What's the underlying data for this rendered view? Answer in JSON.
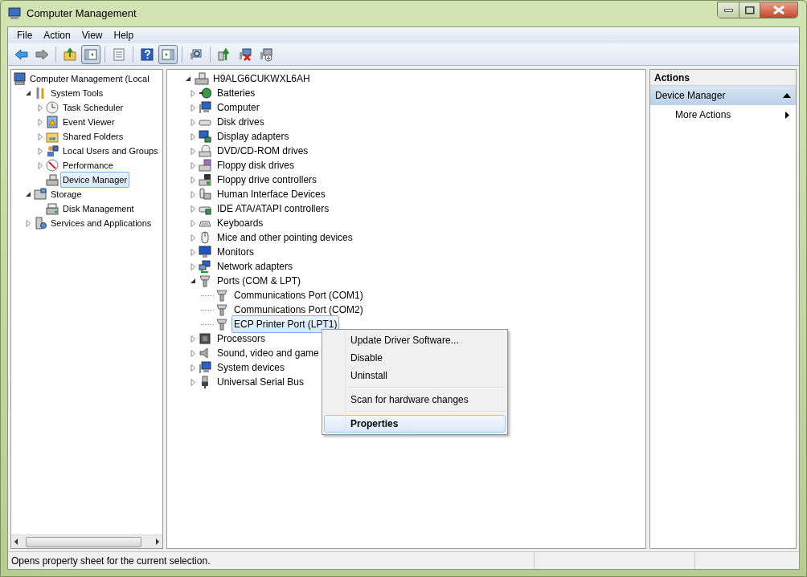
{
  "window": {
    "title": "Computer Management"
  },
  "menu_bar": [
    "File",
    "Action",
    "View",
    "Help"
  ],
  "toolbar": [
    {
      "pressed": false
    },
    {
      "pressed": false
    },
    {
      "pressed": false
    },
    {
      "pressed": true
    },
    {
      "pressed": false
    },
    {
      "pressed": false
    },
    {
      "pressed": true
    },
    {
      "pressed": false
    },
    {
      "pressed": false
    },
    {
      "pressed": false
    },
    {
      "pressed": false
    }
  ],
  "console_tree": [
    {
      "label": "Computer Management (Local",
      "selected": false,
      "children": [
        {
          "label": "System Tools",
          "expanded": true,
          "selected": false,
          "children": [
            {
              "label": "Task Scheduler",
              "expanded": false,
              "selected": false
            },
            {
              "label": "Event Viewer",
              "expanded": false,
              "selected": false
            },
            {
              "label": "Shared Folders",
              "expanded": false,
              "selected": false
            },
            {
              "label": "Local Users and Groups",
              "expanded": false,
              "selected": false
            },
            {
              "label": "Performance",
              "expanded": false,
              "selected": false
            },
            {
              "label": "Device Manager",
              "selected": true
            }
          ]
        },
        {
          "label": "Storage",
          "expanded": true,
          "selected": false,
          "children": [
            {
              "label": "Disk Management",
              "selected": false
            }
          ]
        },
        {
          "label": "Services and Applications",
          "expanded": false,
          "selected": false
        }
      ]
    }
  ],
  "device_tree": {
    "label": "H9ALG6CUKWXL6AH",
    "expanded": true,
    "children": [
      {
        "label": "Batteries",
        "expanded": false,
        "selected": false
      },
      {
        "label": "Computer",
        "expanded": false,
        "selected": false
      },
      {
        "label": "Disk drives",
        "expanded": false,
        "selected": false
      },
      {
        "label": "Display adapters",
        "expanded": false,
        "selected": false
      },
      {
        "label": "DVD/CD-ROM drives",
        "expanded": false,
        "selected": false
      },
      {
        "label": "Floppy disk drives",
        "expanded": false,
        "selected": false
      },
      {
        "label": "Floppy drive controllers",
        "expanded": false,
        "selected": false
      },
      {
        "label": "Human Interface Devices",
        "expanded": false,
        "selected": false
      },
      {
        "label": "IDE ATA/ATAPI controllers",
        "expanded": false,
        "selected": false
      },
      {
        "label": "Keyboards",
        "expanded": false,
        "selected": false
      },
      {
        "label": "Mice and other pointing devices",
        "expanded": false,
        "selected": false
      },
      {
        "label": "Monitors",
        "expanded": false,
        "selected": false
      },
      {
        "label": "Network adapters",
        "expanded": false,
        "selected": false
      },
      {
        "label": "Ports (COM & LPT)",
        "expanded": true,
        "selected": false,
        "children": [
          {
            "label": "Communications Port (COM1)",
            "selected": false
          },
          {
            "label": "Communications Port (COM2)",
            "selected": false
          },
          {
            "label": "ECP Printer Port (LPT1)",
            "selected": true
          }
        ]
      },
      {
        "label": "Processors",
        "expanded": false,
        "selected": false
      },
      {
        "label": "Sound, video and game",
        "expanded": false,
        "selected": false
      },
      {
        "label": "System devices",
        "expanded": false,
        "selected": false
      },
      {
        "label": "Universal Serial Bus",
        "expanded": false,
        "selected": false
      }
    ]
  },
  "context_menu": [
    {
      "label": "Update Driver Software...",
      "separator_before": false,
      "default": false,
      "selected": false
    },
    {
      "label": "Disable",
      "separator_before": false,
      "default": false,
      "selected": false
    },
    {
      "label": "Uninstall",
      "separator_before": false,
      "default": false,
      "selected": false
    },
    {
      "label": "Scan for hardware changes",
      "separator_before": true,
      "default": false,
      "selected": false
    },
    {
      "label": "Properties",
      "separator_before": true,
      "default": true,
      "selected": true
    }
  ],
  "actions_pane": {
    "title": "Actions",
    "sections": [
      {
        "label": "Device Manager",
        "expanded": true,
        "items": [
          {
            "label": "More Actions",
            "submenu": true
          }
        ]
      }
    ]
  },
  "status_bar": {
    "text": "Opens property sheet for the current selection."
  }
}
